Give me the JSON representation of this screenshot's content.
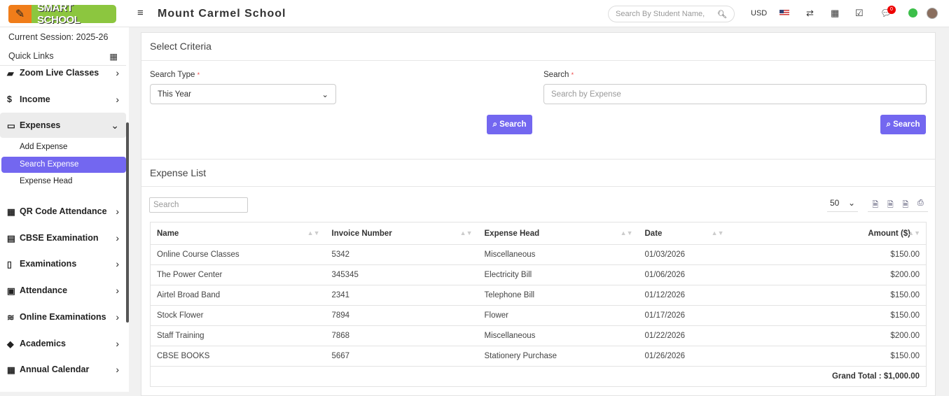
{
  "header": {
    "logo": "SMART SCHOOL",
    "school": "Mount Carmel School",
    "search_placeholder": "Search By Student Name,",
    "currency": "USD",
    "notif_count": "0"
  },
  "sidebar": {
    "session": "Current Session: 2025-26",
    "quick_links": "Quick Links",
    "items": [
      {
        "label": "Zoom Live Classes",
        "icon": "▰"
      },
      {
        "label": "Income",
        "icon": "$"
      },
      {
        "label": "Expenses",
        "icon": "▭"
      },
      {
        "label": "QR Code Attendance",
        "icon": "▦"
      },
      {
        "label": "CBSE Examination",
        "icon": "▤"
      },
      {
        "label": "Examinations",
        "icon": "▯"
      },
      {
        "label": "Attendance",
        "icon": "▣"
      },
      {
        "label": "Online Examinations",
        "icon": "≋"
      },
      {
        "label": "Academics",
        "icon": "◆"
      },
      {
        "label": "Annual Calendar",
        "icon": "▦"
      }
    ],
    "sub": [
      "Add Expense",
      "Search Expense",
      "Expense Head"
    ]
  },
  "criteria": {
    "title": "Select Criteria",
    "type_label": "Search Type",
    "type_value": "This Year",
    "search_label": "Search",
    "search_placeholder": "Search by Expense",
    "button": "Search"
  },
  "list": {
    "title": "Expense List",
    "search_placeholder": "Search",
    "page_size": "50",
    "columns": [
      "Name",
      "Invoice Number",
      "Expense Head",
      "Date",
      "Amount ($)"
    ],
    "rows": [
      [
        "Online Course Classes",
        "5342",
        "Miscellaneous",
        "01/03/2026",
        "$150.00"
      ],
      [
        "The Power Center",
        "345345",
        "Electricity Bill",
        "01/06/2026",
        "$200.00"
      ],
      [
        "Airtel Broad Band",
        "2341",
        "Telephone Bill",
        "01/12/2026",
        "$150.00"
      ],
      [
        "Stock Flower",
        "7894",
        "Flower",
        "01/17/2026",
        "$150.00"
      ],
      [
        "Staff Training",
        "7868",
        "Miscellaneous",
        "01/22/2026",
        "$200.00"
      ],
      [
        "CBSE BOOKS",
        "5667",
        "Stationery Purchase",
        "01/26/2026",
        "$150.00"
      ]
    ],
    "total": "Grand Total : $1,000.00"
  }
}
